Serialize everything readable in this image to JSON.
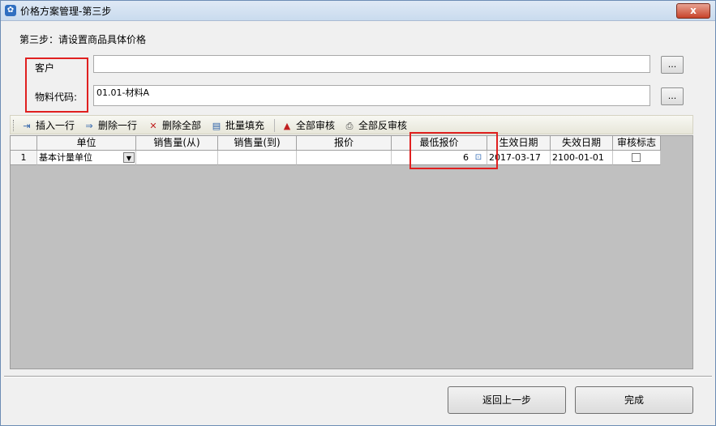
{
  "window": {
    "title": "价格方案管理-第三步",
    "close_label": "x"
  },
  "step": "第三步：请设置商品具体价格",
  "form": {
    "customer_label": "客户",
    "customer_value": "",
    "material_label": "物料代码:",
    "material_value": "01.01-材料A",
    "browse_label": "..."
  },
  "toolbar": {
    "insert_row": "插入一行",
    "delete_row": "删除一行",
    "delete_all": "删除全部",
    "batch_fill": "批量填充",
    "approve_all": "全部审核",
    "unapprove_all": "全部反审核"
  },
  "grid": {
    "columns": [
      "单位",
      "销售量(从)",
      "销售量(到)",
      "报价",
      "最低报价",
      "生效日期",
      "失效日期",
      "审核标志"
    ],
    "rows": [
      {
        "num": "1",
        "unit": "基本计量单位",
        "qty_from": "",
        "qty_to": "",
        "quote": "",
        "min_quote": "6",
        "effective_date": "2017-03-17",
        "expire_date": "2100-01-01",
        "approved": false
      }
    ]
  },
  "buttons": {
    "back": "返回上一步",
    "finish": "完成"
  }
}
